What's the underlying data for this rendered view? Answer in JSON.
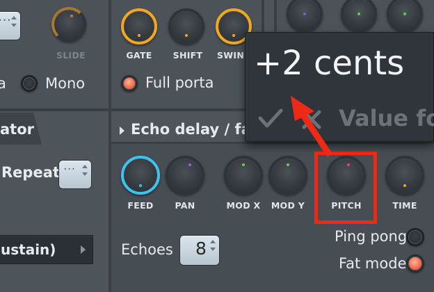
{
  "top_left": {
    "slide_label": "SLIDE",
    "porta_partial": "a",
    "mono_label": "Mono"
  },
  "top_knobs": {
    "gate_label": "GATE",
    "shift_label": "SHIFT",
    "swing_label": "SWIN"
  },
  "full_porta_label": "Full porta",
  "left_section": {
    "title_partial": "ator",
    "repeat_label": "Repeat",
    "dropdown_value": "ustain)"
  },
  "echo_section": {
    "title": "Echo delay / fat",
    "knobs": {
      "feed": "FEED",
      "pan": "PAN",
      "mod_x": "MOD X",
      "mod_y": "MOD Y",
      "pitch": "PITCH",
      "time": "TIME"
    },
    "echoes_label": "Echoes",
    "echoes_value": "8",
    "ping_pong_label": "Ping pong",
    "fat_mode_label": "Fat mode"
  },
  "tooltip": {
    "value_text": "+2 cents",
    "confirm_text": "Value for"
  },
  "colors": {
    "accent_orange": "#f0a722",
    "accent_cyan": "#3dc3ee",
    "highlight_red": "#ee2a17",
    "led_on": "#f26a4a"
  },
  "icons": [
    "chevron-right-icon",
    "checkmark-icon",
    "close-icon",
    "arrow-pointer-icon"
  ]
}
